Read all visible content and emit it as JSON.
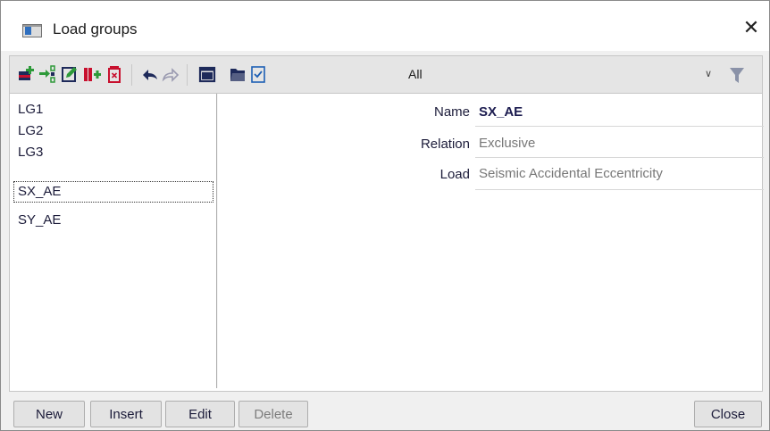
{
  "window": {
    "title": "Load groups"
  },
  "toolbar": {
    "icons": [
      "new-icon",
      "insert-icon",
      "edit-icon",
      "split-icon",
      "delete-icon",
      "undo-icon",
      "redo-icon",
      "layout-icon",
      "folder-icon",
      "checklist-icon"
    ],
    "filter_value": "All"
  },
  "list": {
    "items": [
      "LG1",
      "LG2",
      "LG3",
      "SX_AE",
      "SY_AE"
    ],
    "selected": "SX_AE"
  },
  "properties": {
    "name": {
      "label": "Name",
      "value": "SX_AE"
    },
    "relation": {
      "label": "Relation",
      "value": "Exclusive"
    },
    "load": {
      "label": "Load",
      "value": "Seismic Accidental Eccentricity"
    }
  },
  "buttons": {
    "new": "New",
    "insert": "Insert",
    "edit": "Edit",
    "delete": "Delete",
    "close": "Close"
  },
  "colors": {
    "icon_red": "#c8102e",
    "icon_green": "#2e9a3a",
    "icon_navy": "#1e2a5a",
    "icon_blue": "#1d5fb4"
  }
}
